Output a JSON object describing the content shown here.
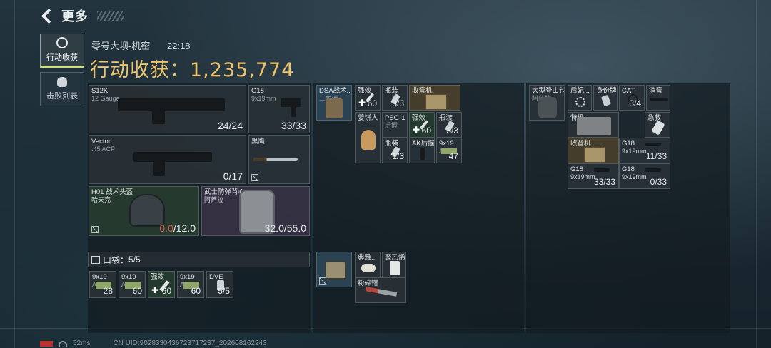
{
  "top": {
    "title": "更多"
  },
  "sidetabs": [
    {
      "label": "行动收获"
    },
    {
      "label": "击败列表"
    }
  ],
  "header": {
    "map": "零号大坝-机密",
    "time": "22:18"
  },
  "loot": {
    "label": "行动收获：",
    "value": "1,235,774"
  },
  "equip": {
    "primary": {
      "name": "S12K",
      "ammo": "12 Gauge",
      "count": "24/24"
    },
    "pistol": {
      "name": "G18",
      "ammo": "9x19mm",
      "count": "33/33"
    },
    "secondary": {
      "name": "Vector",
      "ammo": ".45 ACP",
      "count": "0/17"
    },
    "melee": {
      "name": "黑鹰"
    },
    "helmet": {
      "name": "H01 战术头盔",
      "sub": "哈夫克",
      "dur_cur": "0.0",
      "dur_max": "/12.0"
    },
    "armor": {
      "name": "武士防弹背心",
      "sub": "阿萨拉",
      "dur": "32.0/55.0"
    }
  },
  "pocket": {
    "label": "口袋：",
    "cap": "5/5",
    "items": [
      {
        "name": "9x19",
        "sub": "AP",
        "count": "28"
      },
      {
        "name": "9x19",
        "sub": "AP",
        "count": "60"
      },
      {
        "name": "强效",
        "count": "60"
      },
      {
        "name": "9x19",
        "sub": "AP",
        "count": "60"
      },
      {
        "name": "DVE",
        "count": "5/5"
      }
    ]
  },
  "vest": {
    "name": "DSA战术...",
    "sub": "三角洲",
    "items": [
      {
        "name": "强效",
        "count": "60"
      },
      {
        "name": "瓶装",
        "count": "3/3"
      },
      {
        "name": "收音机"
      },
      {
        "name": "姜饼人"
      },
      {
        "name": "PSG-1",
        "sub": "后握"
      },
      {
        "name": "强效",
        "count": "60"
      },
      {
        "name": "瓶装",
        "count": "3/3"
      },
      {
        "name": "瓶装",
        "count": "1/3"
      },
      {
        "name": "AK后握"
      },
      {
        "name": "9x19",
        "sub": "AP",
        "count": "47"
      }
    ]
  },
  "case": {
    "items": [
      {
        "name": "典雅..."
      },
      {
        "name": "聚乙烯"
      },
      {
        "name": "粉碎钳"
      }
    ]
  },
  "backpack": {
    "name": "大型登山包",
    "sub": "阿萨拉",
    "items": [
      {
        "name": "后妃..."
      },
      {
        "name": "身份牌"
      },
      {
        "name": "CAT",
        "count": "3/4"
      },
      {
        "name": "消音"
      },
      {
        "name": "特级..."
      },
      {
        "name": "急救"
      },
      {
        "name": "收音机"
      },
      {
        "name": "G18",
        "sub": "9x19mm",
        "count": "11/33"
      },
      {
        "name": "G18",
        "sub": "9x19mm",
        "count": "33/33"
      },
      {
        "name": "G18",
        "sub": "9x19mm",
        "count": "0/33"
      }
    ]
  },
  "status": {
    "ping": "52ms",
    "uid": "CN UID:9028330436723717237_202608162243"
  }
}
